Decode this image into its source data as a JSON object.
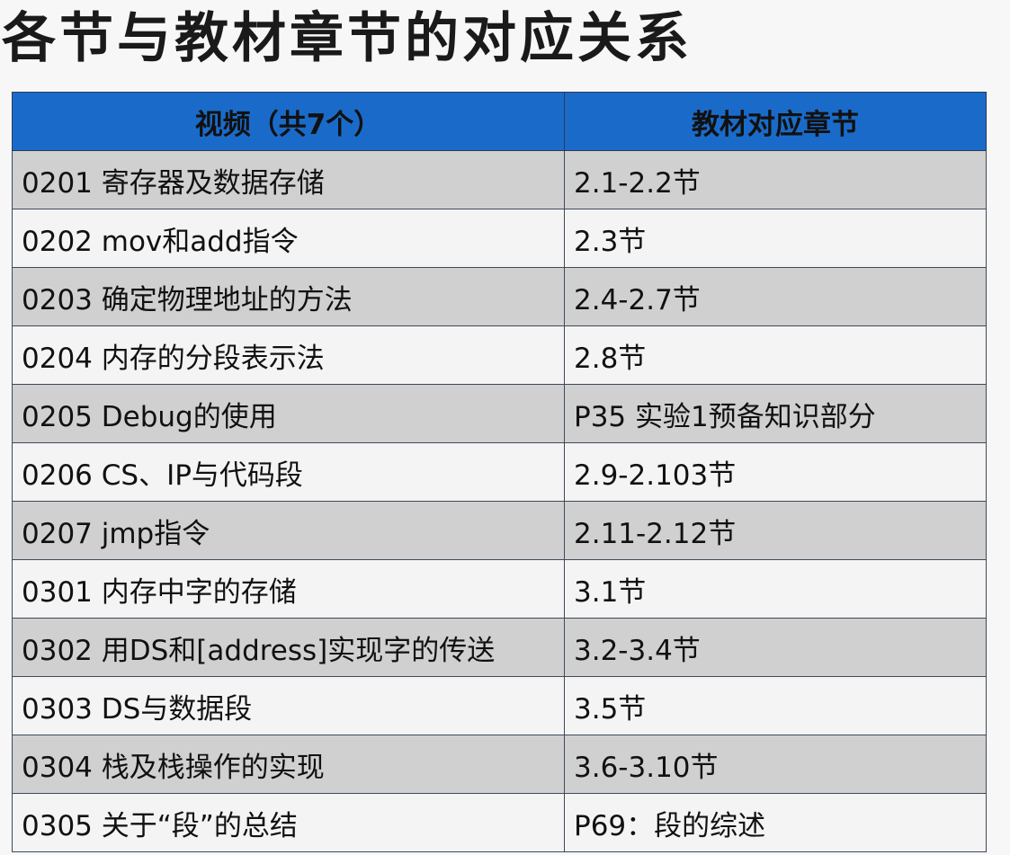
{
  "title": "各节与教材章节的对应关系",
  "table": {
    "headers": [
      "视频（共7个）",
      "教材对应章节"
    ],
    "rows": [
      {
        "video": "0201 寄存器及数据存储",
        "chapter": "2.1-2.2节"
      },
      {
        "video": "0202 mov和add指令",
        "chapter": "2.3节"
      },
      {
        "video": "0203 确定物理地址的方法",
        "chapter": "2.4-2.7节"
      },
      {
        "video": "0204 内存的分段表示法",
        "chapter": "2.8节"
      },
      {
        "video": "0205 Debug的使用",
        "chapter": "P35 实验1预备知识部分"
      },
      {
        "video": "0206 CS、IP与代码段",
        "chapter": "2.9-2.103节"
      },
      {
        "video": "0207 jmp指令",
        "chapter": "2.11-2.12节"
      },
      {
        "video": "0301 内存中字的存储",
        "chapter": "3.1节"
      },
      {
        "video": "0302 用DS和[address]实现字的传送",
        "chapter": "3.2-3.4节"
      },
      {
        "video": "0303 DS与数据段",
        "chapter": "3.5节"
      },
      {
        "video": "0304 栈及栈操作的实现",
        "chapter": "3.6-3.10节"
      },
      {
        "video": "0305 关于“段”的总结",
        "chapter": "P69：段的综述"
      }
    ]
  },
  "colors": {
    "header_bg": "#1a6bc9",
    "row_odd": "#d0d0d0",
    "row_even": "#f4f4f4"
  }
}
